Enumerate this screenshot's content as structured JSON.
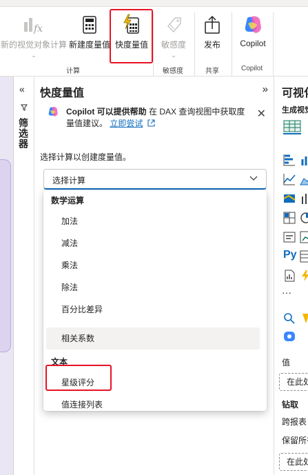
{
  "ribbon": {
    "buttons": {
      "new_visual_calc": "新的视觉对象计算",
      "new_measure": "新建度量值",
      "quick_measure": "快度量值",
      "sensitivity": "敏感度",
      "publish": "发布",
      "copilot": "Copilot"
    },
    "groups": {
      "calc": "计算",
      "sensitivity": "敏感度",
      "share": "共享",
      "copilot": "Copilot"
    }
  },
  "filters": {
    "label": "筛选器",
    "collapse_glyph": "«"
  },
  "quick_measure_pane": {
    "title": "快度量值",
    "expand_glyph": "»",
    "banner": {
      "bold": "Copilot 可以提供帮助",
      "text": " 在 DAX 查询视图中获取度量值建议。",
      "link": "立即尝试"
    },
    "prompt": "选择计算以创建度量值。",
    "select": {
      "value": "选择计算"
    },
    "dropdown": {
      "section_math": "数学运算",
      "math_items": [
        "加法",
        "减法",
        "乘法",
        "除法",
        "百分比差异",
        "相关系数"
      ],
      "section_text": "文本",
      "text_items": [
        "星级评分",
        "值连接列表"
      ]
    }
  },
  "visual_pane": {
    "title": "可视化",
    "subtitle": "生成视觉对象",
    "py_label": "Py",
    "ellipsis": "···",
    "values_label": "值",
    "values_placeholder": "在此处添加数据字段",
    "drill_label": "钻取",
    "cross_report": "跨报表",
    "keep_filters": "保留所有筛选器",
    "drill_placeholder": "在此处添加钻取字段"
  },
  "colors": {
    "highlight": "#e81123",
    "accent": "#0f6cbd",
    "quick_measure_icon": "#f2b700"
  }
}
